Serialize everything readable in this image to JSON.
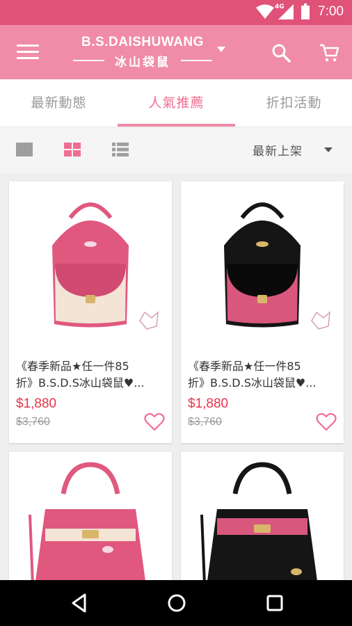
{
  "status_bar": {
    "time": "7:00",
    "network": "4G"
  },
  "app_bar": {
    "brand": "B.S.DAISHUWANG",
    "brand_sub": "冰山袋鼠",
    "menu_icon": "menu-icon",
    "search_icon": "search-icon",
    "cart_icon": "cart-icon",
    "color": "#f08ca8"
  },
  "tabs": [
    {
      "label": "最新動態",
      "active": false
    },
    {
      "label": "人氣推薦",
      "active": true
    },
    {
      "label": "折扣活動",
      "active": false
    }
  ],
  "toolbar": {
    "views": [
      "single-view-icon",
      "grid-view-icon",
      "list-view-icon"
    ],
    "active_view": "grid-view-icon",
    "sort_label": "最新上架"
  },
  "products": [
    {
      "title_line1": "《春季新品★任一件85",
      "title_line2": "折》B.S.D.S冰山袋鼠♥...",
      "price": "$1,880",
      "original_price": "$3,760",
      "bag_color": "#e0587e",
      "accent_color": "#f3e4d6"
    },
    {
      "title_line1": "《春季新品★任一件85",
      "title_line2": "折》B.S.D.S冰山袋鼠♥...",
      "price": "$1,880",
      "original_price": "$3,760",
      "bag_color": "#151515",
      "accent_color": "#d9577d"
    },
    {
      "bag_color": "#e0587e",
      "accent_color": "#f3e4d6"
    },
    {
      "bag_color": "#151515",
      "accent_color": "#d9577d"
    }
  ],
  "colors": {
    "accent": "#f06e92",
    "status_bar": "#e05278",
    "price": "#e8334a"
  }
}
